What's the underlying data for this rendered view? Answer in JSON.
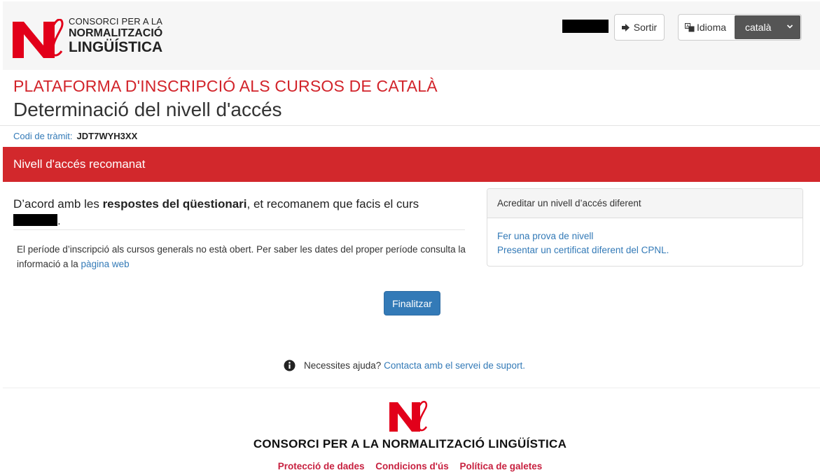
{
  "header": {
    "logo_line1": "CONSORCI PER A LA",
    "logo_line2": "NORMALITZACIÓ",
    "logo_line3": "LINGÜÍSTICA",
    "sortir_label": "Sortir",
    "idioma_label": "Idioma",
    "language_selected": "català"
  },
  "page": {
    "platform_title": "PLATAFORMA D'INSCRIPCIÓ ALS CURSOS DE CATALÀ",
    "title": "Determinació del nivell d'accés",
    "codi_label": "Codi de tràmit:",
    "codi_value": "JDT7WYH3XX",
    "section_title": "Nivell d'accés recomanat",
    "reco_prefix": "D’acord amb les ",
    "reco_bold": "respostes del qüestionari",
    "reco_suffix": ", et recomanem que facis el curs",
    "notice_text": "El període d’inscripció als cursos generals no està obert. Per saber les dates del proper període consulta la informació a la ",
    "notice_link": "pàgina web",
    "finalize_label": "Finalitzar"
  },
  "panel": {
    "title": "Acreditar un nivell d’accés diferent",
    "link1": "Fer una prova de nivell",
    "link2": "Presentar un certificat diferent del CPNL."
  },
  "help": {
    "text": "Necessites ajuda?",
    "link": "Contacta amb el servei de suport."
  },
  "footer": {
    "org_name": "CONSORCI PER A LA NORMALITZACIÓ LINGÜÍSTICA",
    "links": [
      "Protecció de dades",
      "Condicions d'ús",
      "Política de galetes"
    ]
  },
  "colors": {
    "brand_red": "#d2232a",
    "link_blue": "#337ab7",
    "primary_button": "#337ab7"
  }
}
